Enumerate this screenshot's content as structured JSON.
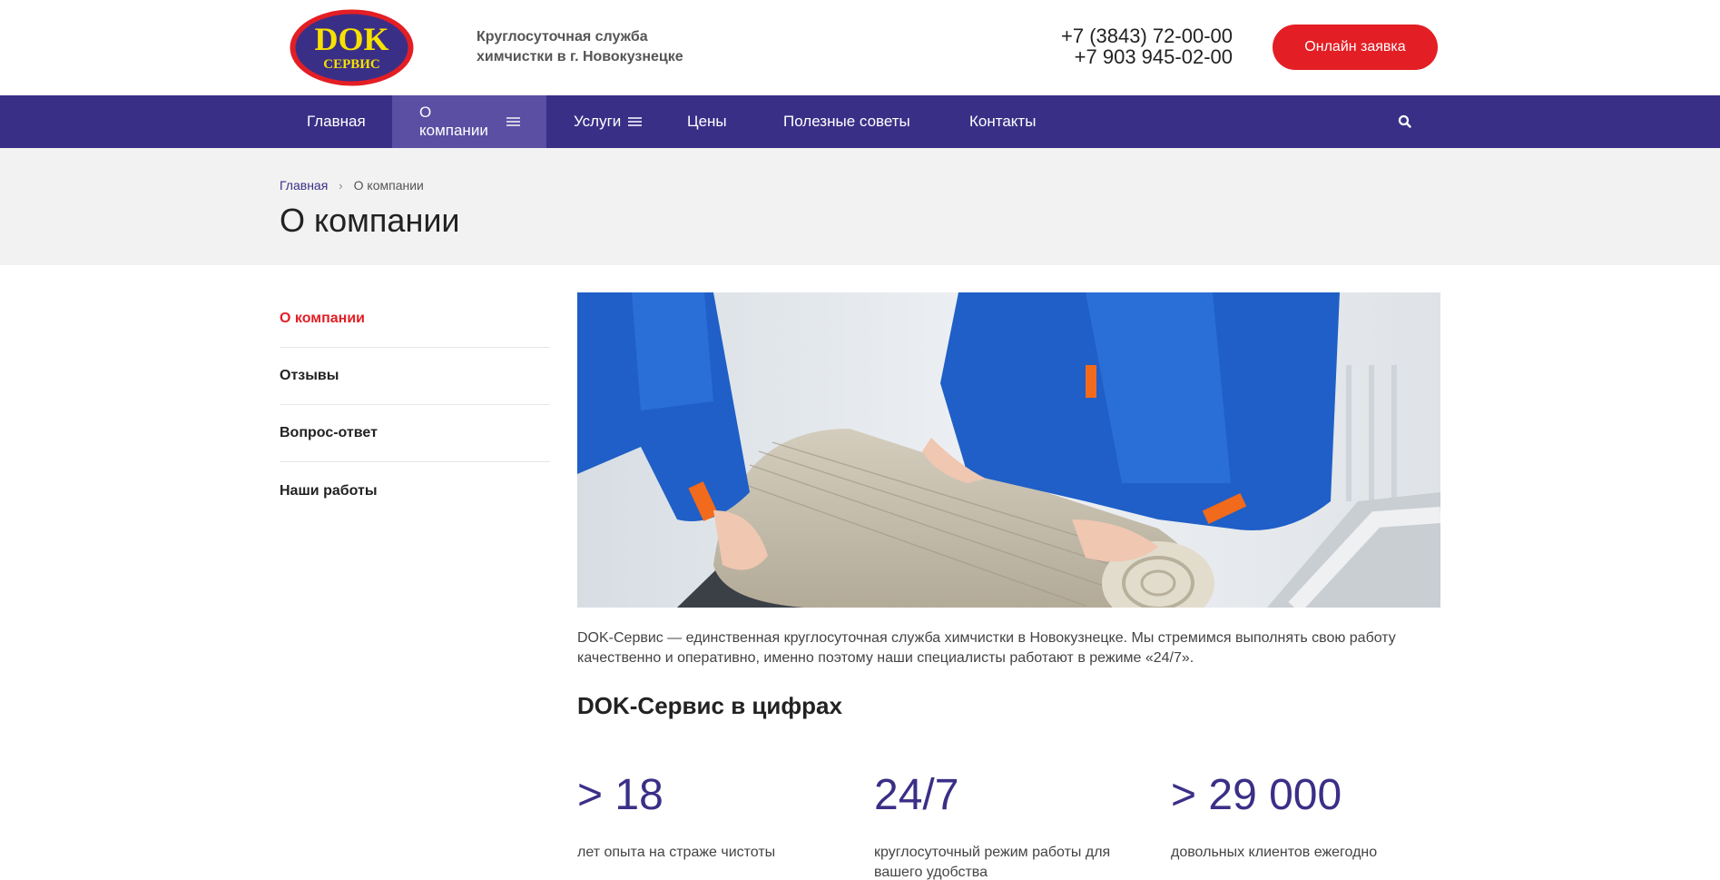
{
  "header": {
    "logo": {
      "top_text": "DOK",
      "bottom_text": "СЕРВИС"
    },
    "tagline": [
      "Круглосуточная служба",
      "химчистки в г. Новокузнецке"
    ],
    "phones": [
      "+7 (3843) 72-00-00",
      "+7 903 945-02-00"
    ],
    "cta_label": "Онлайн заявка",
    "colors": {
      "brand": "#3a2f87",
      "accent": "#e31e24"
    }
  },
  "nav": {
    "items": [
      {
        "label": "Главная"
      },
      {
        "label": "О компании"
      },
      {
        "label": "Услуги"
      },
      {
        "label": "Цены"
      },
      {
        "label": "Полезные советы"
      },
      {
        "label": "Контакты"
      }
    ],
    "active": "О компании",
    "search_icon": "search-icon"
  },
  "breadcrumb": {
    "home": "Главная",
    "current": "О компании"
  },
  "page_title": "О компании",
  "sidebar": {
    "items": [
      {
        "label": "О компании"
      },
      {
        "label": "Отзывы"
      },
      {
        "label": "Вопрос-ответ"
      },
      {
        "label": "Наши работы"
      }
    ]
  },
  "main": {
    "intro": "DOK-Сервис — единственная круглосуточная служба химчистки в Новокузнецке. Мы стремимся выполнять свою работу качественно и оперативно, именно поэтому наши специалисты работают в режиме «24/7».",
    "stats_title": "DOK-Сервис в цифрах",
    "stats": [
      {
        "value": "> 18",
        "caption": "лет опыта на страже чистоты"
      },
      {
        "value": "24/7",
        "caption": "круглосуточный режим работы для вашего удобства"
      },
      {
        "value": "> 29 000",
        "caption": "довольных клиентов ежегодно"
      }
    ]
  }
}
